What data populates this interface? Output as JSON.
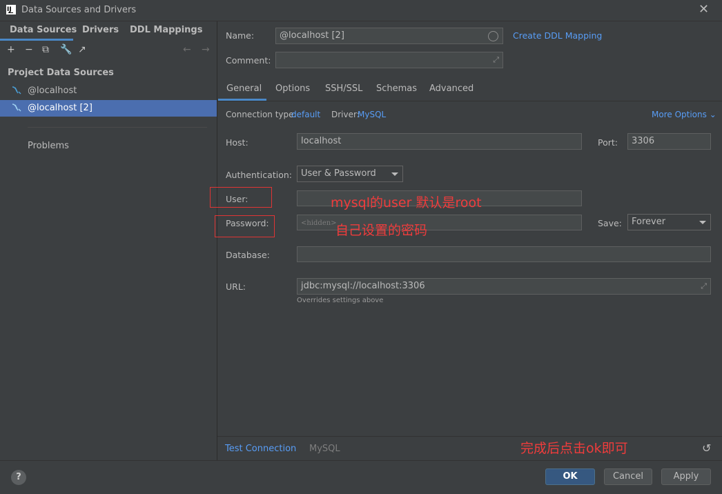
{
  "window": {
    "title": "Data Sources and Drivers",
    "app_icon_text": "IJ"
  },
  "left_tabs": [
    "Data Sources",
    "Drivers",
    "DDL Mappings"
  ],
  "toolbar": {
    "add": "+",
    "remove": "−",
    "copy": "⧉",
    "settings": "🔧",
    "jump": "↗",
    "back": "←",
    "forward": "→"
  },
  "section_title": "Project Data Sources",
  "data_sources": [
    {
      "label": "@localhost",
      "selected": false
    },
    {
      "label": "@localhost [2]",
      "selected": true
    }
  ],
  "problems_label": "Problems",
  "name": {
    "label": "Name:",
    "value": "@localhost [2]"
  },
  "comment": {
    "label": "Comment:",
    "value": ""
  },
  "create_ddl_link": "Create DDL Mapping",
  "right_tabs": [
    "General",
    "Options",
    "SSH/SSL",
    "Schemas",
    "Advanced"
  ],
  "connection": {
    "type_label": "Connection type:",
    "type_value": "default",
    "driver_label": "Driver:",
    "driver_value": "MySQL",
    "more_options": "More Options"
  },
  "host": {
    "label": "Host:",
    "value": "localhost"
  },
  "port": {
    "label": "Port:",
    "value": "3306"
  },
  "authentication": {
    "label": "Authentication:",
    "value": "User & Password"
  },
  "user": {
    "label": "User:",
    "value": ""
  },
  "password": {
    "label": "Password:",
    "placeholder": "<hidden>"
  },
  "save": {
    "label": "Save:",
    "value": "Forever"
  },
  "database": {
    "label": "Database:",
    "value": ""
  },
  "url": {
    "label": "URL:",
    "value": "jdbc:mysql://localhost:3306",
    "hint": "Overrides settings above"
  },
  "annotations": {
    "user_note": "mysql的user  默认是root",
    "password_note": "自己设置的密码",
    "footer_note": "完成后点击ok即可"
  },
  "bottom_bar": {
    "test_connection": "Test Connection",
    "driver_name": "MySQL",
    "revert": "↺"
  },
  "footer": {
    "help": "?",
    "ok": "OK",
    "cancel": "Cancel",
    "apply": "Apply"
  },
  "colors": {
    "accent": "#589df6",
    "selection": "#4b6eaf",
    "annotation": "#f03c3c"
  }
}
